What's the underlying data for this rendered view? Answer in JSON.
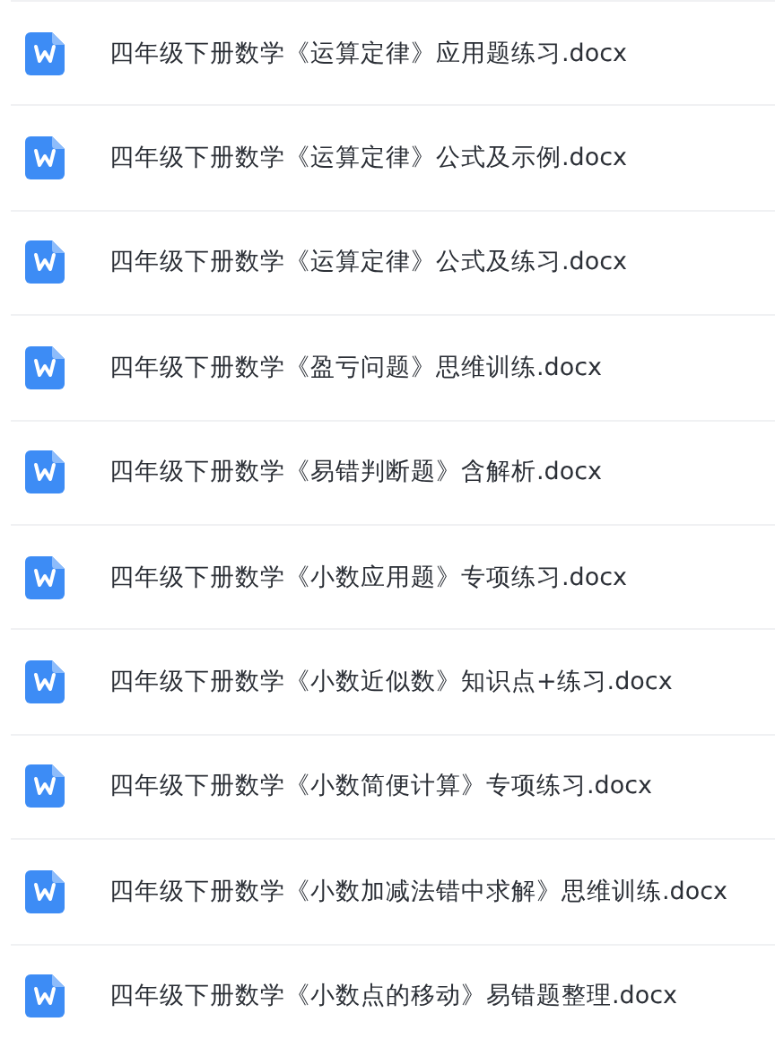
{
  "files": [
    {
      "name": "四年级下册数学《运算定律》应用题练习.docx"
    },
    {
      "name": "四年级下册数学《运算定律》公式及示例.docx"
    },
    {
      "name": "四年级下册数学《运算定律》公式及练习.docx"
    },
    {
      "name": "四年级下册数学《盈亏问题》思维训练.docx"
    },
    {
      "name": "四年级下册数学《易错判断题》含解析.docx"
    },
    {
      "name": "四年级下册数学《小数应用题》专项练习.docx"
    },
    {
      "name": "四年级下册数学《小数近似数》知识点+练习.docx"
    },
    {
      "name": "四年级下册数学《小数简便计算》专项练习.docx"
    },
    {
      "name": "四年级下册数学《小数加减法错中求解》思维训练.docx"
    },
    {
      "name": "四年级下册数学《小数点的移动》易错题整理.docx"
    }
  ]
}
